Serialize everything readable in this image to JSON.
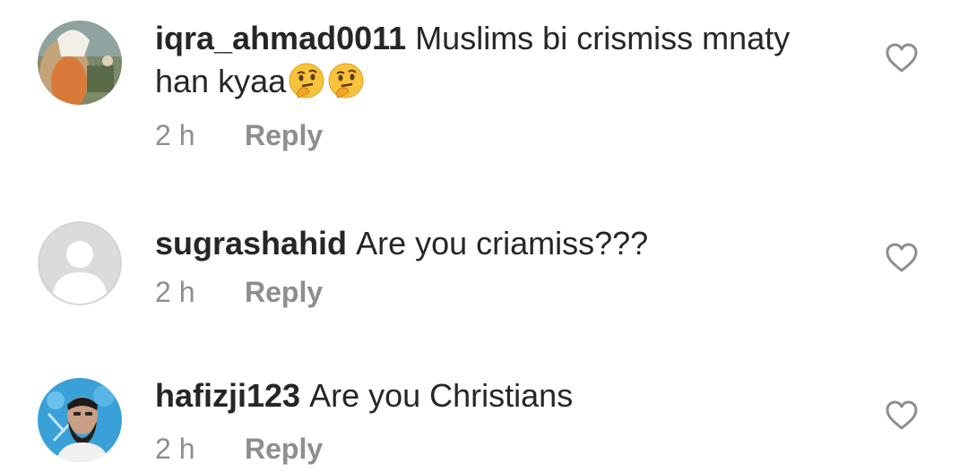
{
  "comments": [
    {
      "username": "iqra_ahmad0011",
      "text": "Muslims bi crismiss mnaty han kyaa",
      "emojis": [
        "thinking-face",
        "thinking-face"
      ],
      "time": "2 h",
      "reply_label": "Reply"
    },
    {
      "username": "sugrashahid",
      "text": "Are you criamiss???",
      "time": "2 h",
      "reply_label": "Reply"
    },
    {
      "username": "hafizji123",
      "text": "Are you Christians",
      "time": "2 h",
      "reply_label": "Reply"
    }
  ],
  "colors": {
    "text": "#262626",
    "meta": "#8e8e8e",
    "heart_outline": "#8e8e8e",
    "default_avatar_bg": "#dbdbdb"
  },
  "icons": {
    "like": "heart-outline-icon",
    "default_avatar": "default-avatar-icon"
  }
}
